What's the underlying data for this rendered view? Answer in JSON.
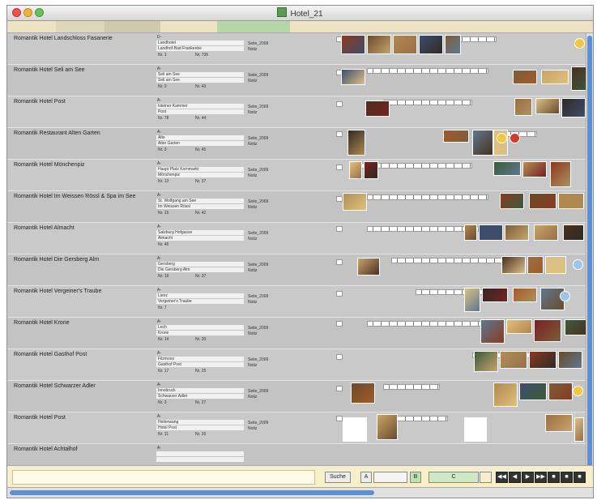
{
  "window": {
    "title": "Hotel_21"
  },
  "header_segments": [
    {
      "color": "#ede2c3",
      "w": 60
    },
    {
      "color": "#ded6b8",
      "w": 60
    },
    {
      "color": "#cfc9ae",
      "w": 70
    },
    {
      "color": "#ede2c3",
      "w": 70
    },
    {
      "color": "#b7d5a9",
      "w": 90
    },
    {
      "color": "#ede2c3",
      "w": 375
    }
  ],
  "records": [
    {
      "name": "Romantik Hotel Landschloss Fasanerie",
      "country": "D-",
      "street": "Landhotel",
      "city": "Landhof-Bad Frankenbe",
      "num1": "Nr. 1",
      "num2": "Nr. 736",
      "page": "Seite_2009",
      "note": "Notiz"
    },
    {
      "name": "Romantik Hotel Seli am See",
      "country": "A-",
      "street": "Seli am See",
      "city": "Seli am See",
      "num1": "Nr. 3",
      "num2": "Nr. 43",
      "page": "Seite_2009",
      "note": "Notiz"
    },
    {
      "name": "Romantik Hotel Post",
      "country": "A-",
      "street": "Isteiner Kammer",
      "city": "Post",
      "num1": "Nr. 78",
      "num2": "Nr. 44",
      "page": "Seite_2009",
      "note": "Notiz"
    },
    {
      "name": "Romantik Restaurant Alten Garten",
      "country": "A-",
      "street": "Alte",
      "city": "Alter Garten",
      "num1": "Nr. 3",
      "num2": "Nr. 45",
      "page": "Seite_2009",
      "note": "Notiz"
    },
    {
      "name": "Romantik Hotel Mönchenpiz",
      "country": "A-",
      "street": "Haupt Platz Kornmarkt",
      "city": "Mönchenpiz",
      "num1": "Nr. 13",
      "num2": "Nr. 37",
      "page": "Seite_2009",
      "note": "Notiz"
    },
    {
      "name": "Romantik Hotel Im Weissen Rössl & Spa im See",
      "country": "A-",
      "street": "St. Wolfgang am See",
      "city": "Im Weissen Rössl",
      "num1": "Nr. 15",
      "num2": "Nr. 42",
      "page": "Seite_2009",
      "note": "Notiz"
    },
    {
      "name": "Romantik Hotel Almacht",
      "country": "A-",
      "street": "Salzburg Hofgasse",
      "city": "Almacht",
      "num1": "Nr. 46",
      "num2": "",
      "page": "Seite_2009",
      "note": "Notiz"
    },
    {
      "name": "Romantik Hotel Die Gersberg Alm",
      "country": "A-",
      "street": "Gersberg",
      "city": "Die Gersberg Alm",
      "num1": "Nr. 19",
      "num2": "Nr. 37",
      "page": "Seite_2009",
      "note": "Notiz"
    },
    {
      "name": "Romantik Hotel Vergeiner's Traube",
      "country": "A-",
      "street": "Lienz",
      "city": "Vergeiner's Traube",
      "num1": "Nr. 7",
      "num2": "",
      "page": "Seite_2009",
      "note": "Notiz"
    },
    {
      "name": "Romantik Hotel Krone",
      "country": "A-",
      "street": "Lech",
      "city": "Krone",
      "num1": "Nr. 14",
      "num2": "Nr. 20",
      "page": "Seite_2009",
      "note": "Notiz"
    },
    {
      "name": "Romantik Hotel Gasthof Post",
      "country": "A-",
      "street": "Filzmoos",
      "city": "Gasthof Post",
      "num1": "Nr. 17",
      "num2": "Nr. 25",
      "page": "Seite_2009",
      "note": "Notiz"
    },
    {
      "name": "Romantik Hotel Schwarzer Adler",
      "country": "A-",
      "street": "Innsbruck",
      "city": "Schwarzer Adler",
      "num1": "Nr. 3",
      "num2": "Nr. 27",
      "page": "Seite_2009",
      "note": "Notiz"
    },
    {
      "name": "Romantik Hotel Post",
      "country": "A-",
      "street": "Heiterwang",
      "city": "Hotel Post",
      "num1": "Nr. 11",
      "num2": "Nr. 20",
      "page": "Seite_2009",
      "note": "Notiz"
    },
    {
      "name": "Romantik Hotel Achtalhof",
      "country": "A-",
      "street": "",
      "city": "",
      "num1": "",
      "num2": "",
      "page": "",
      "note": ""
    }
  ],
  "thumb_colors": [
    "#8a3a22",
    "#6b4b2a",
    "#b08850",
    "#3e4d6b",
    "#7b5e3c",
    "#c8a46a",
    "#4a3020",
    "#9a7045",
    "#d9c08a",
    "#2f2a25",
    "#a35a2b",
    "#5d7890",
    "#e2c07a",
    "#7a2020",
    "#3b5b3b",
    "#b0905a"
  ],
  "badge_colors": {
    "yellow": "#f2c542",
    "red": "#d23a2a",
    "blue": "#9ec4ea"
  },
  "toolbar": {
    "btn_a": "Suche",
    "btn_b": "A",
    "btn_c": "B",
    "btn_d": "C",
    "nav": [
      "◀◀",
      "◀",
      "▶",
      "▶▶",
      "■",
      "■",
      "■"
    ]
  }
}
